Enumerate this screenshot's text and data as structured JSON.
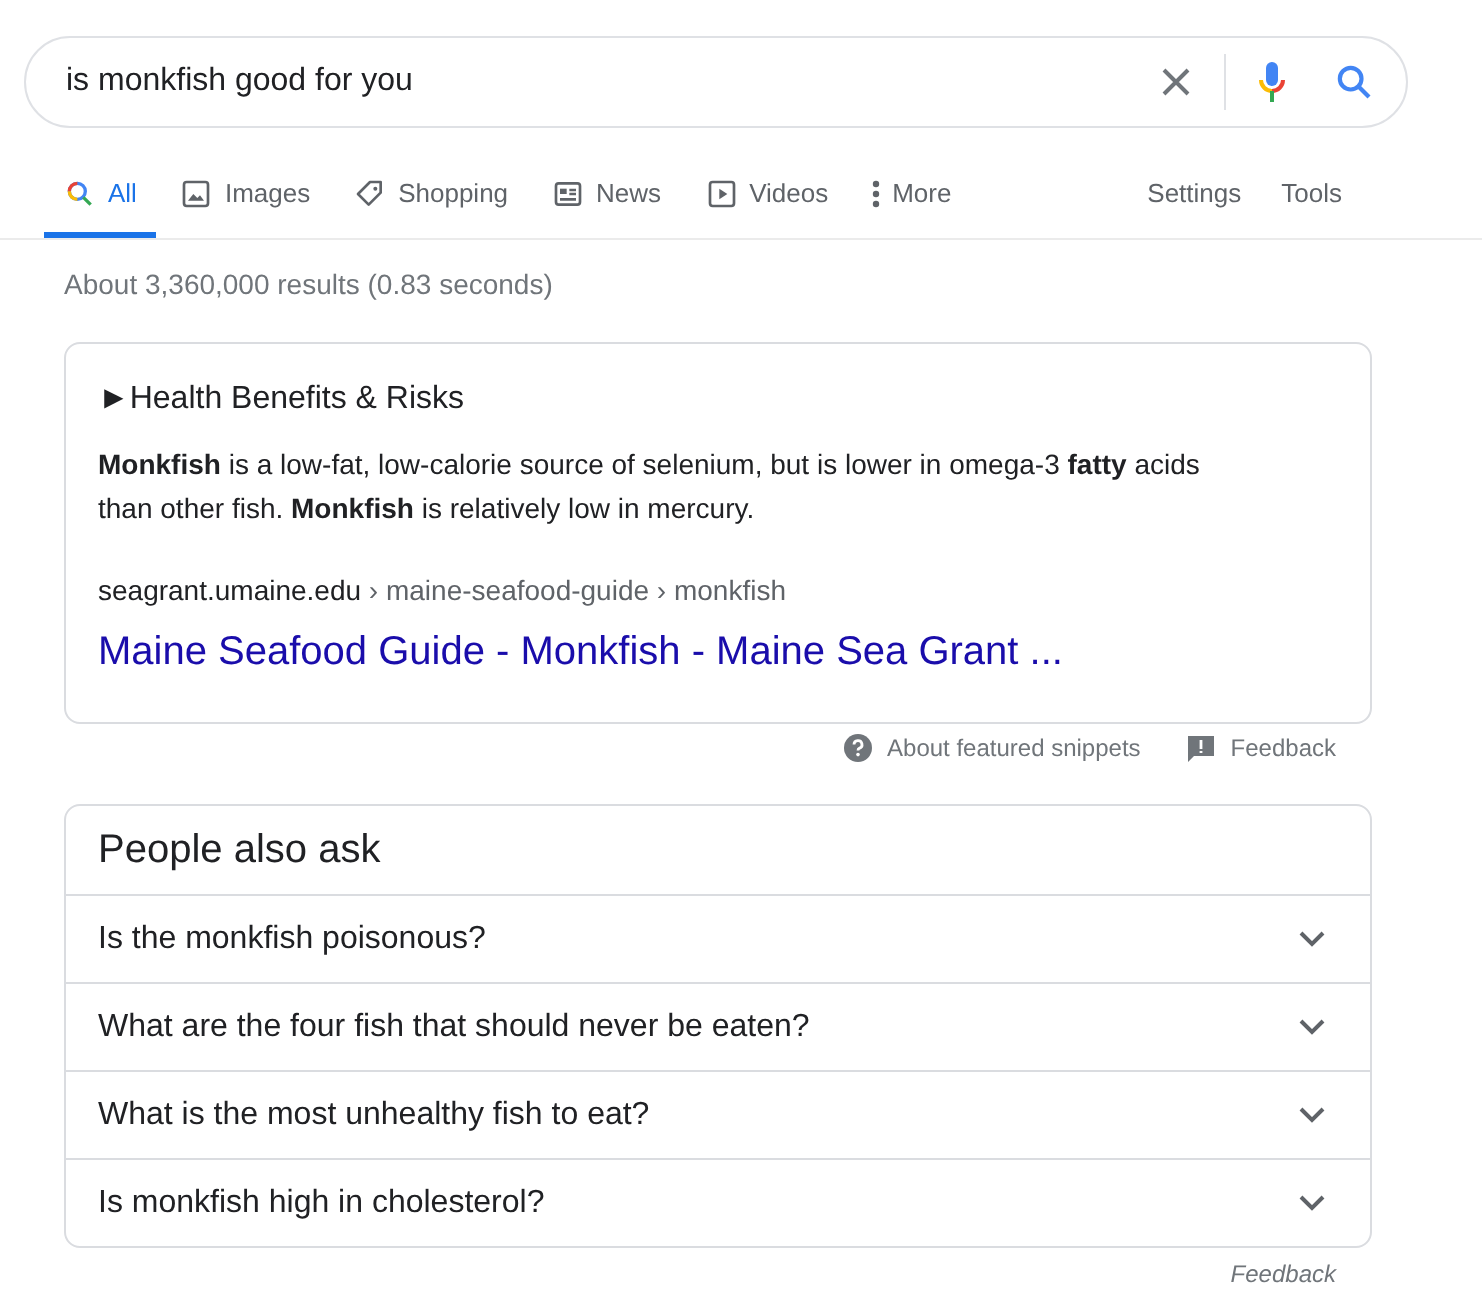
{
  "search": {
    "value": "is monkfish good for you"
  },
  "tabs": [
    {
      "kind": "all",
      "label": "All",
      "selected": true
    },
    {
      "kind": "images",
      "label": "Images",
      "selected": false
    },
    {
      "kind": "shopping",
      "label": "Shopping",
      "selected": false
    },
    {
      "kind": "news",
      "label": "News",
      "selected": false
    },
    {
      "kind": "videos",
      "label": "Videos",
      "selected": false
    },
    {
      "kind": "more",
      "label": "More",
      "selected": false
    }
  ],
  "tools": [
    "Settings",
    "Tools"
  ],
  "result_stats": "About 3,360,000 results (0.83 seconds)",
  "snippet": {
    "heading": "►Health Benefits & Risks",
    "text": "**Monkfish** is a low-fat, low-calorie source of selenium, but is lower in omega-3 **fatty** acids than other fish. **Monkfish** is relatively low in mercury.",
    "site": "seagrant.umaine.edu",
    "path": " › maine-seafood-guide › monkfish",
    "link": "Maine Seafood Guide - Monkfish - Maine Sea Grant ..."
  },
  "snippet_footer": {
    "about": "About featured snippets",
    "feedback": "Feedback"
  },
  "people_also_ask": {
    "title": "People also ask",
    "questions": [
      {
        "text": "Is the monkfish poisonous?",
        "expanded": false
      },
      {
        "text": "What are the four fish that should never be eaten?",
        "expanded": false
      },
      {
        "text": "What is the most unhealthy fish to eat?",
        "expanded": false
      },
      {
        "text": "Is monkfish high in cholesterol?",
        "expanded": false
      }
    ],
    "feedback": "Feedback"
  }
}
